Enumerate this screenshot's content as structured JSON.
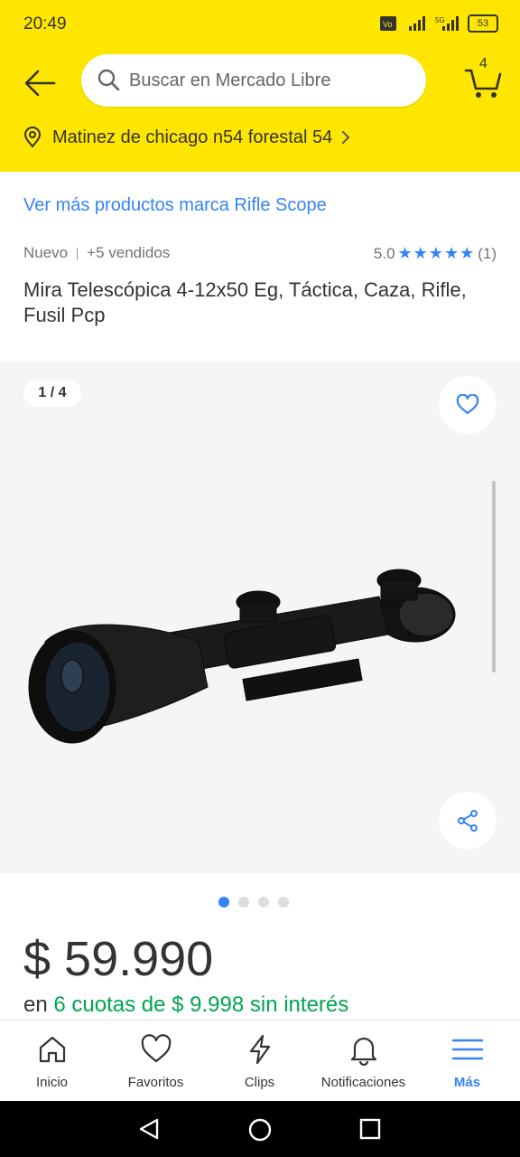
{
  "status": {
    "time": "20:49",
    "battery": "53"
  },
  "search": {
    "placeholder": "Buscar en Mercado Libre"
  },
  "cart": {
    "count": "4"
  },
  "address": {
    "text": "Matinez de chicago n54 forestal 54"
  },
  "product": {
    "brand_link": "Ver más productos marca Rifle Scope",
    "condition": "Nuevo",
    "sold": "+5 vendidos",
    "rating_value": "5.0",
    "stars_filled": 5,
    "review_count": "(1)",
    "title": "Mira Telescópica 4-12x50 Eg, Táctica, Caza, Rifle, Fusil Pcp",
    "image_counter": "1 / 4",
    "image_index": 1,
    "image_total": 4,
    "price": "$ 59.990",
    "installments_prefix": "en",
    "installments_text": "6 cuotas de $ 9.998 sin interés"
  },
  "tabs": [
    {
      "label": "Inicio",
      "icon": "home-icon"
    },
    {
      "label": "Favoritos",
      "icon": "heart-icon"
    },
    {
      "label": "Clips",
      "icon": "lightning-icon"
    },
    {
      "label": "Notificaciones",
      "icon": "bell-icon"
    },
    {
      "label": "Más",
      "icon": "menu-icon"
    }
  ],
  "colors": {
    "header": "#ffe600",
    "accent": "#3483fa",
    "green": "#00a650"
  }
}
